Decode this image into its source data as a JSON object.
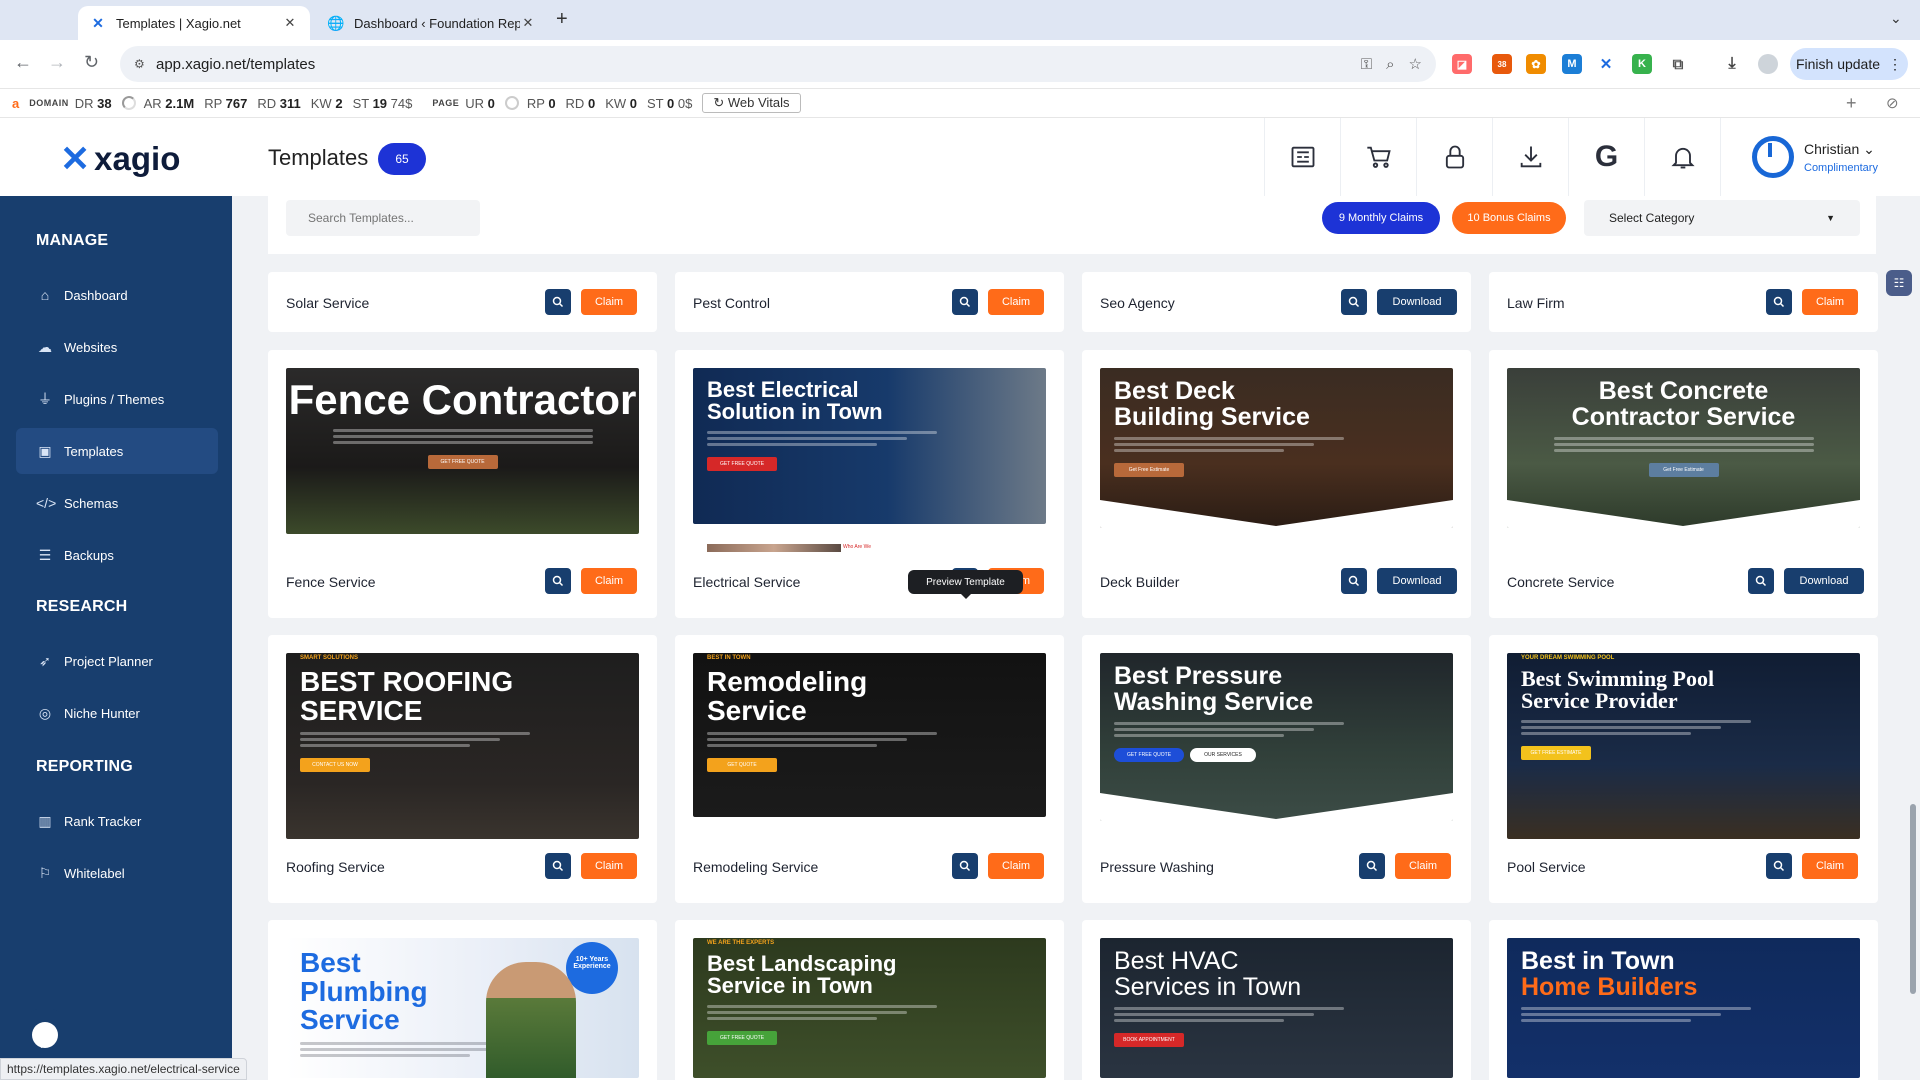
{
  "browser": {
    "tabs": [
      {
        "title": "Templates | Xagio.net",
        "close": "✕"
      },
      {
        "title": "Dashboard ‹ Foundation Rep",
        "close": "✕"
      }
    ],
    "new_tab": "+",
    "url": "app.xagio.net/templates",
    "finish_update": "Finish update",
    "extension_badge": "38",
    "status_url": "https://templates.xagio.net/electrical-service"
  },
  "seo_bar": {
    "domain_label": "DOMAIN",
    "domain_metrics": [
      {
        "k": "DR",
        "v": "38"
      },
      {
        "k": "AR",
        "v": "2.1M"
      },
      {
        "k": "RP",
        "v": "767"
      },
      {
        "k": "RD",
        "v": "311"
      },
      {
        "k": "KW",
        "v": "2"
      },
      {
        "k": "ST",
        "v": "19",
        "extra": "74$"
      }
    ],
    "page_label": "PAGE",
    "page_metrics": [
      {
        "k": "UR",
        "v": "0"
      },
      {
        "k": "RP",
        "v": "0"
      },
      {
        "k": "RD",
        "v": "0"
      },
      {
        "k": "KW",
        "v": "0"
      },
      {
        "k": "ST",
        "v": "0",
        "extra": "0$"
      }
    ],
    "web_vitals": "Web Vitals"
  },
  "header": {
    "logo": "xagio",
    "page_title": "Templates",
    "template_count": "65",
    "user_name": "Christian",
    "user_plan": "Complimentary",
    "icons": [
      "newspaper-icon",
      "cart-icon",
      "lock-icon",
      "download-icon",
      "google-icon",
      "bell-icon"
    ]
  },
  "sidebar": {
    "sections": [
      {
        "title": "MANAGE",
        "items": [
          {
            "label": "Dashboard",
            "icon": "home-icon"
          },
          {
            "label": "Websites",
            "icon": "cloud-icon"
          },
          {
            "label": "Plugins / Themes",
            "icon": "plug-icon"
          },
          {
            "label": "Templates",
            "icon": "image-icon",
            "active": true
          },
          {
            "label": "Schemas",
            "icon": "code-icon"
          },
          {
            "label": "Backups",
            "icon": "database-icon"
          }
        ]
      },
      {
        "title": "RESEARCH",
        "items": [
          {
            "label": "Project Planner",
            "icon": "rocket-icon"
          },
          {
            "label": "Niche Hunter",
            "icon": "target-icon"
          }
        ]
      },
      {
        "title": "REPORTING",
        "items": [
          {
            "label": "Rank Tracker",
            "icon": "chart-icon"
          },
          {
            "label": "Whitelabel",
            "icon": "bookmark-icon"
          }
        ]
      }
    ]
  },
  "filters": {
    "search_placeholder": "Search Templates...",
    "monthly_claims": "9 Monthly Claims",
    "bonus_claims": "10 Bonus Claims",
    "category": "Select Category"
  },
  "colors": {
    "primary": "#183e6e",
    "accent": "#ff6b19",
    "badge": "#1d33d6"
  },
  "tooltip": "Preview Template",
  "top_cards": [
    {
      "name": "Solar Service",
      "action": "Claim"
    },
    {
      "name": "Pest Control",
      "action": "Claim"
    },
    {
      "name": "Seo Agency",
      "action": "Download"
    },
    {
      "name": "Law Firm",
      "action": "Claim"
    }
  ],
  "rows": [
    [
      {
        "name": "Fence Service",
        "action": "Claim",
        "headline": [
          "Fence Contractor"
        ],
        "cta": "GET FREE QUOTE"
      },
      {
        "name": "Electrical Service",
        "action": "Claim",
        "headline": [
          "Best Electrical",
          "Solution in Town"
        ],
        "cta": "GET FREE QUOTE",
        "extra": "Who Are We"
      },
      {
        "name": "Deck Builder",
        "action": "Download",
        "headline": [
          "Best Deck",
          "Building Service"
        ],
        "cta": "Get Free Estimate"
      },
      {
        "name": "Concrete Service",
        "action": "Download",
        "headline": [
          "Best Concrete",
          "Contractor Service"
        ],
        "cta": "Get Free Estimate"
      }
    ],
    [
      {
        "name": "Roofing Service",
        "action": "Claim",
        "headline": [
          "BEST ROOFING",
          "SERVICE"
        ],
        "kicker": "SMART SOLUTIONS",
        "cta": "CONTACT US NOW"
      },
      {
        "name": "Remodeling Service",
        "action": "Claim",
        "headline": [
          "Remodeling",
          "Service"
        ],
        "kicker": "BEST IN TOWN",
        "cta": "GET QUOTE"
      },
      {
        "name": "Pressure Washing",
        "action": "Claim",
        "headline": [
          "Best Pressure",
          "Washing Service"
        ],
        "cta": "GET FREE QUOTE",
        "cta2": "OUR SERVICES"
      },
      {
        "name": "Pool Service",
        "action": "Claim",
        "headline": [
          "Best Swimming Pool",
          "Service Provider"
        ],
        "kicker": "YOUR DREAM SWIMMING POOL",
        "cta": "GET FREE ESTIMATE"
      }
    ],
    [
      {
        "headline": [
          "Best",
          "Plumbing",
          "Service"
        ],
        "badge": "10+ Years Experience"
      },
      {
        "headline": [
          "Best Landscaping",
          "Service in Town"
        ],
        "kicker": "WE ARE THE EXPERTS",
        "cta": "GET FREE QUOTE"
      },
      {
        "headline": [
          "Best HVAC",
          "Services in Town"
        ],
        "cta": "BOOK APPOINTMENT"
      },
      {
        "headline": [
          "Best in Town",
          "Home Builders"
        ]
      }
    ]
  ]
}
